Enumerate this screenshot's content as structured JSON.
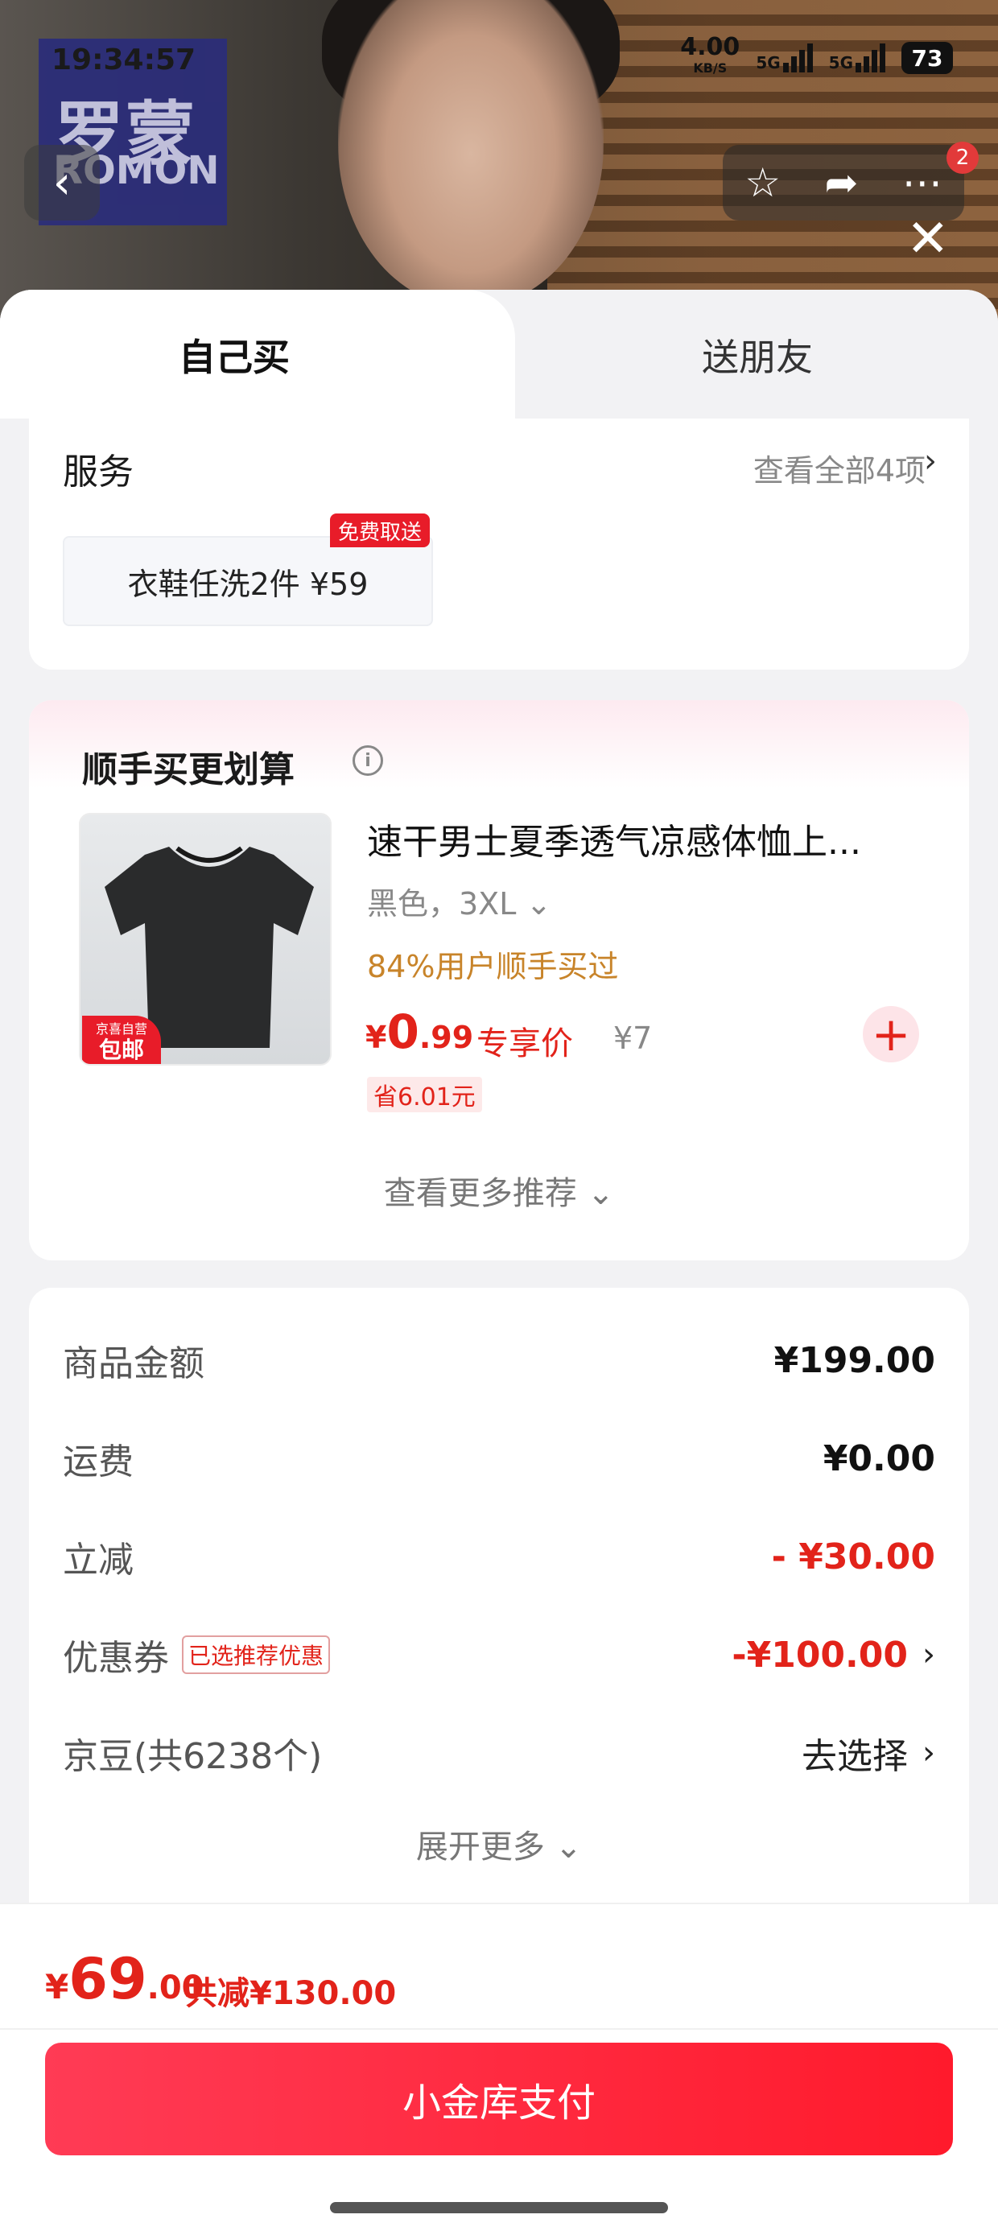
{
  "status_bar": {
    "time": "19:34:57",
    "speed": "4.00",
    "speed_unit": "KB/S",
    "net1": "5G",
    "net2": "5G",
    "battery": "73"
  },
  "brand_logo": {
    "line1": "罗蒙",
    "line2": "ROMON"
  },
  "header": {
    "notification_count": "2"
  },
  "tabs": {
    "self": "自己买",
    "friend": "送朋友"
  },
  "service": {
    "title": "服务",
    "view_all": "查看全部4项",
    "chip_label": "衣鞋任洗2件 ¥59",
    "chip_tag": "免费取送"
  },
  "recommend": {
    "title": "顺手买更划算",
    "product": {
      "name": "速干男士夏季透气凉感体恤上...",
      "variant": "黑色，3XL",
      "users": "84%用户顺手买过",
      "price_currency": "¥",
      "price_int": "0",
      "price_dec": ".99",
      "price_label": "专享价",
      "orig_price": "¥7",
      "save": "省6.01元",
      "ship_tag_line1": "京喜自营",
      "ship_tag_line2": "包邮"
    },
    "see_more": "查看更多推荐"
  },
  "summary": {
    "rows": [
      {
        "label": "商品金额",
        "value": "¥199.00"
      },
      {
        "label": "运费",
        "value": "¥0.00"
      },
      {
        "label": "立减",
        "value": "- ¥30.00"
      },
      {
        "label": "优惠券",
        "tag": "已选推荐优惠",
        "value": "-¥100.00"
      },
      {
        "label": "京豆(共6238个)",
        "value": "去选择"
      }
    ],
    "expand": "展开更多"
  },
  "footer": {
    "total_currency": "¥",
    "total_int": "69",
    "total_dec": ".00",
    "total_saved": "共减¥130.00",
    "pay_button": "小金库支付"
  },
  "colors": {
    "accent_red": "#e2231a",
    "pay_button": "#ff1a2c",
    "orange": "#c8842a"
  }
}
